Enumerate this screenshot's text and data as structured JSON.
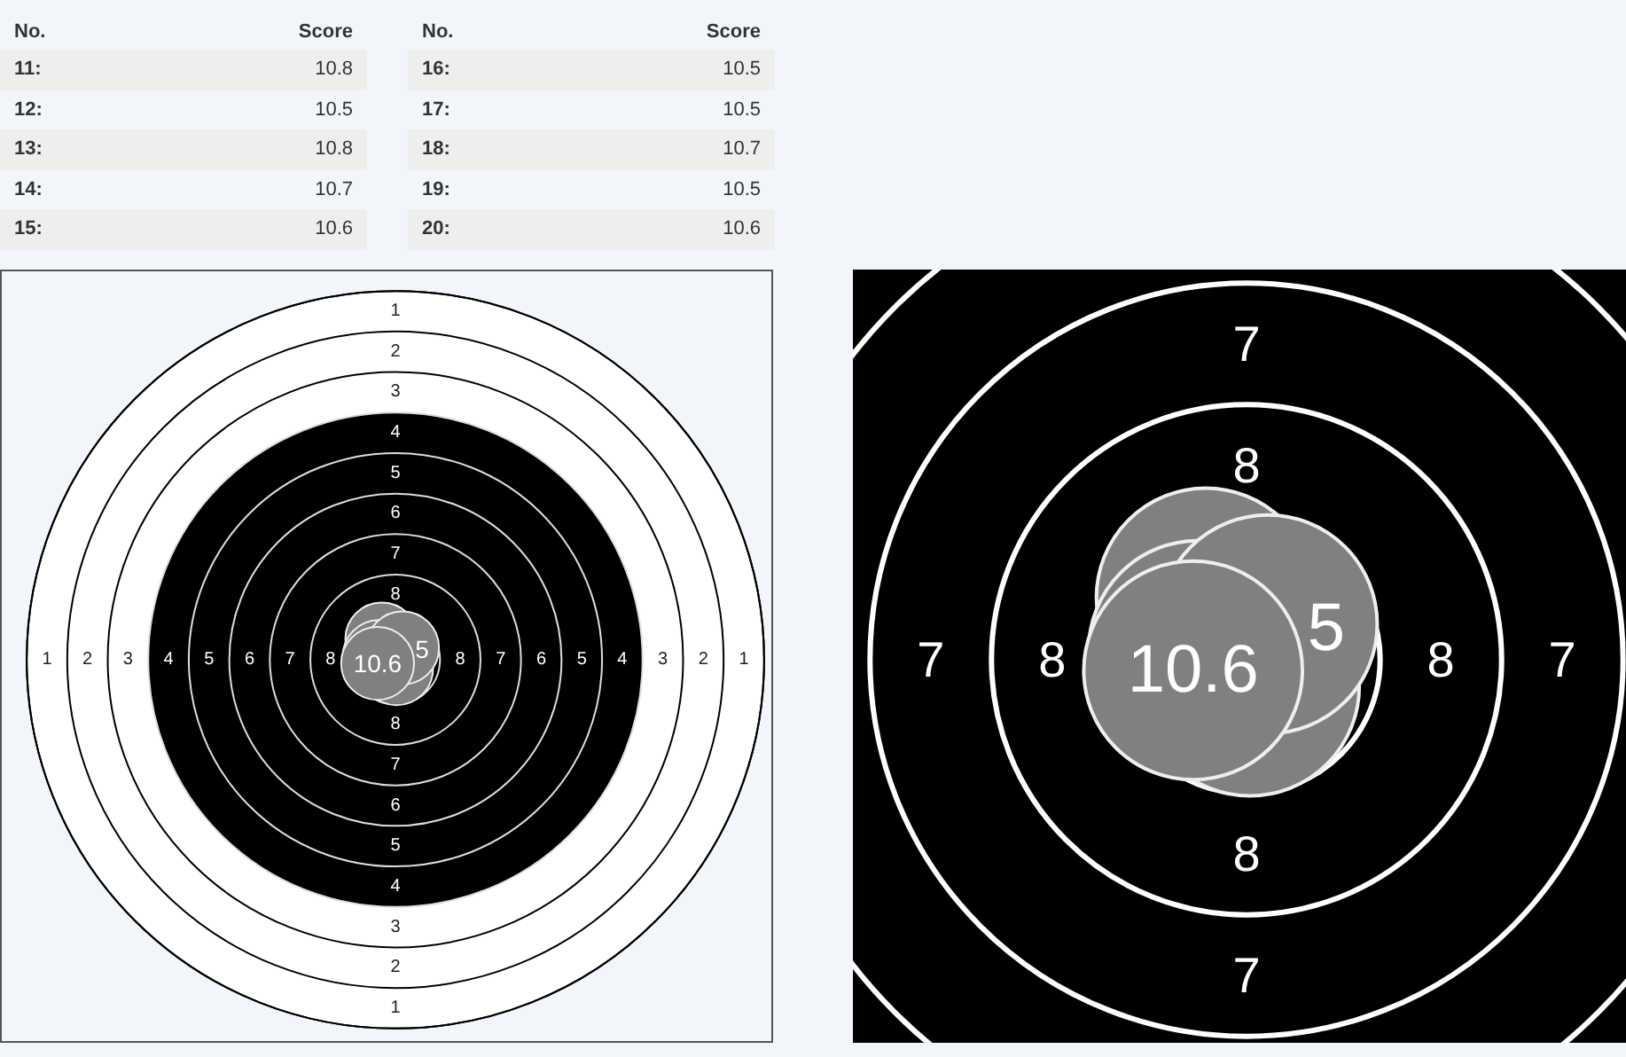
{
  "tables": [
    {
      "columns": [
        "No.",
        "Score"
      ],
      "rows": [
        [
          "11:",
          "10.8"
        ],
        [
          "12:",
          "10.5"
        ],
        [
          "13:",
          "10.8"
        ],
        [
          "14:",
          "10.7"
        ],
        [
          "15:",
          "10.6"
        ]
      ]
    },
    {
      "columns": [
        "No.",
        "Score"
      ],
      "rows": [
        [
          "16:",
          "10.5"
        ],
        [
          "17:",
          "10.5"
        ],
        [
          "18:",
          "10.7"
        ],
        [
          "19:",
          "10.5"
        ],
        [
          "20:",
          "10.6"
        ]
      ]
    }
  ],
  "targets": [
    {
      "kind": "full",
      "top_labels": [
        "1",
        "2",
        "3",
        "4",
        "5",
        "6",
        "7",
        "8"
      ],
      "left_labels": [
        "1",
        "2",
        "3",
        "4",
        "5",
        "6",
        "7",
        "8"
      ],
      "right_labels": [
        "8",
        "7",
        "6",
        "5",
        "4",
        "3",
        "2",
        "1"
      ],
      "bottom_labels": [
        "8",
        "7",
        "6",
        "5",
        "4",
        "3",
        "2",
        "1"
      ],
      "shot_labels": [
        "5",
        "10.6"
      ]
    },
    {
      "kind": "zoom",
      "top_labels": [
        "7",
        "8"
      ],
      "left_labels": [
        "7",
        "8"
      ],
      "right_labels": [
        "8",
        "7"
      ],
      "bottom_labels": [
        "8",
        "7"
      ],
      "shot_labels": [
        "5",
        "10.6"
      ]
    }
  ]
}
